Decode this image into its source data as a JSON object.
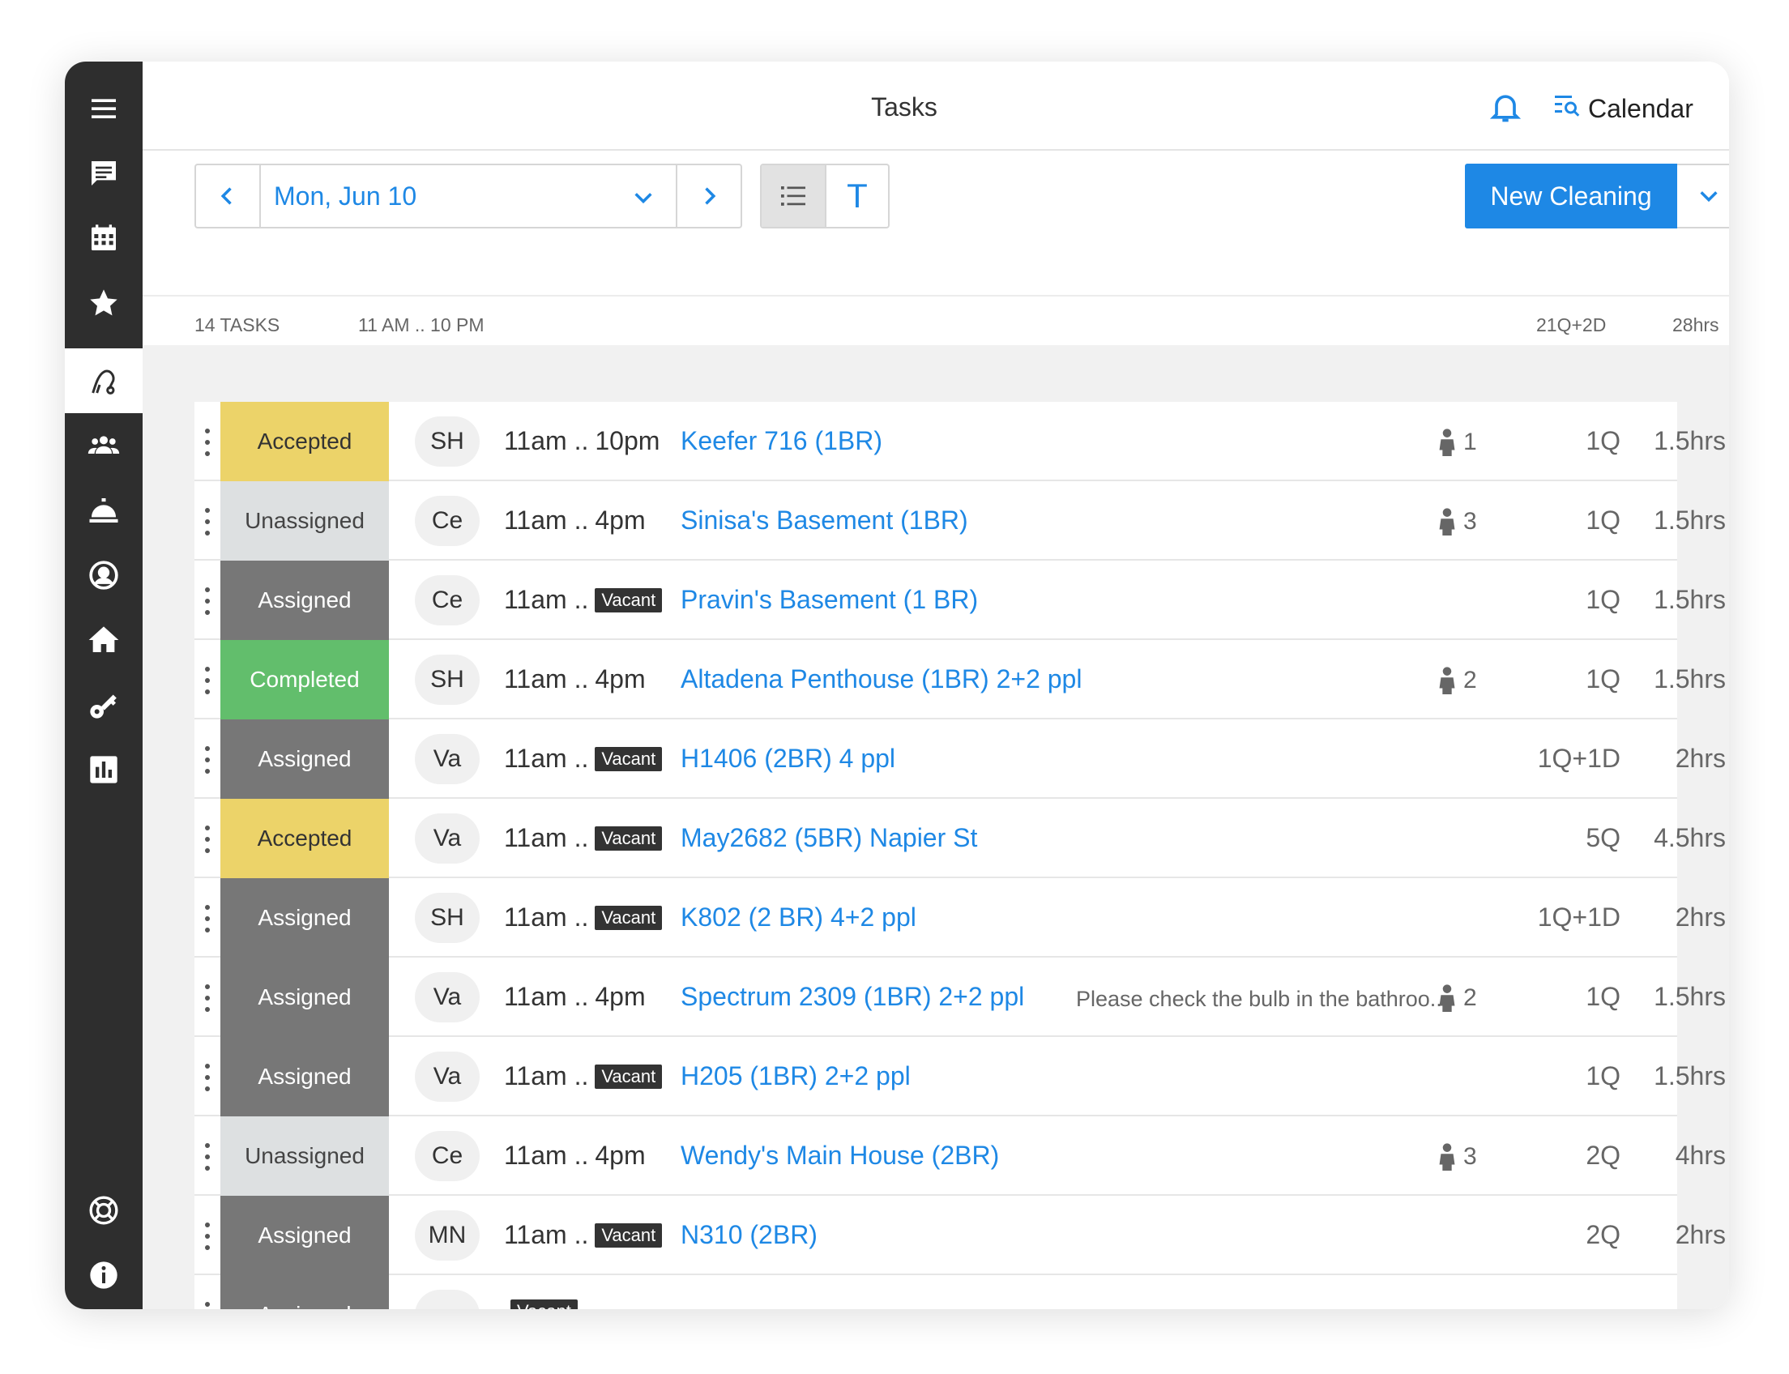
{
  "header": {
    "title": "Tasks",
    "calendar_label": "Calendar"
  },
  "toolbar": {
    "date": "Mon, Jun 10",
    "view_t_label": "T",
    "new_label": "New Cleaning"
  },
  "summary": {
    "tasks": "14 TASKS",
    "range": "11 AM .. 10 PM",
    "qty": "21Q+2D",
    "hours": "28hrs"
  },
  "sidebar": {
    "icons": [
      "menu-icon",
      "messages-icon",
      "calendar-icon",
      "star-icon",
      "cleaning-icon",
      "team-icon",
      "reception-bell-icon",
      "account-icon",
      "home-icon",
      "key-icon",
      "chart-icon",
      "help-icon",
      "info-icon"
    ]
  },
  "colors": {
    "accent": "#1e88e5",
    "accepted": "#ecd369",
    "unassigned": "#dde0e1",
    "assigned": "#777777",
    "completed": "#62be6c",
    "sidebar": "#2e2e2e"
  },
  "tasks": [
    {
      "status": "Accepted",
      "status_key": "accepted",
      "assignee": "SH",
      "time_start": "11am ..",
      "time_end": "10pm",
      "vacant": "",
      "name": "Keefer 716 (1BR)",
      "note": "",
      "guests": "1",
      "qty": "1Q",
      "hours": "1.5hrs"
    },
    {
      "status": "Unassigned",
      "status_key": "unassigned",
      "assignee": "Ce",
      "time_start": "11am ..",
      "time_end": "4pm",
      "vacant": "",
      "name": "Sinisa's Basement (1BR)",
      "note": "",
      "guests": "3",
      "qty": "1Q",
      "hours": "1.5hrs"
    },
    {
      "status": "Assigned",
      "status_key": "assigned",
      "assignee": "Ce",
      "time_start": "11am ..",
      "time_end": "",
      "vacant": "Vacant",
      "name": "Pravin's Basement (1 BR)",
      "note": "",
      "guests": "",
      "qty": "1Q",
      "hours": "1.5hrs"
    },
    {
      "status": "Completed",
      "status_key": "completed",
      "assignee": "SH",
      "time_start": "11am ..",
      "time_end": "4pm",
      "vacant": "",
      "name": "Altadena Penthouse (1BR) 2+2 ppl",
      "note": "",
      "guests": "2",
      "qty": "1Q",
      "hours": "1.5hrs"
    },
    {
      "status": "Assigned",
      "status_key": "assigned",
      "assignee": "Va",
      "time_start": "11am ..",
      "time_end": "",
      "vacant": "Vacant",
      "name": "H1406 (2BR) 4 ppl",
      "note": "",
      "guests": "",
      "qty": "1Q+1D",
      "hours": "2hrs"
    },
    {
      "status": "Accepted",
      "status_key": "accepted",
      "assignee": "Va",
      "time_start": "11am ..",
      "time_end": "",
      "vacant": "Vacant",
      "name": "May2682 (5BR) Napier St",
      "note": "",
      "guests": "",
      "qty": "5Q",
      "hours": "4.5hrs"
    },
    {
      "status": "Assigned",
      "status_key": "assigned",
      "assignee": "SH",
      "time_start": "11am ..",
      "time_end": "",
      "vacant": "Vacant",
      "name": "K802 (2 BR) 4+2 ppl",
      "note": "",
      "guests": "",
      "qty": "1Q+1D",
      "hours": "2hrs"
    },
    {
      "status": "Assigned",
      "status_key": "assigned",
      "assignee": "Va",
      "time_start": "11am ..",
      "time_end": "4pm",
      "vacant": "",
      "name": "Spectrum 2309 (1BR) 2+2 ppl",
      "note": "Please check the bulb in the bathroo...",
      "guests": "2",
      "qty": "1Q",
      "hours": "1.5hrs"
    },
    {
      "status": "Assigned",
      "status_key": "assigned",
      "assignee": "Va",
      "time_start": "11am ..",
      "time_end": "",
      "vacant": "Vacant",
      "name": "H205 (1BR) 2+2 ppl",
      "note": "",
      "guests": "",
      "qty": "1Q",
      "hours": "1.5hrs"
    },
    {
      "status": "Unassigned",
      "status_key": "unassigned",
      "assignee": "Ce",
      "time_start": "11am ..",
      "time_end": "4pm",
      "vacant": "",
      "name": "Wendy's Main House (2BR)",
      "note": "",
      "guests": "3",
      "qty": "2Q",
      "hours": "4hrs"
    },
    {
      "status": "Assigned",
      "status_key": "assigned",
      "assignee": "MN",
      "time_start": "11am ..",
      "time_end": "",
      "vacant": "Vacant",
      "name": "N310 (2BR)",
      "note": "",
      "guests": "",
      "qty": "2Q",
      "hours": "2hrs"
    },
    {
      "status": "Assigned",
      "status_key": "assigned",
      "assignee": "",
      "time_start": "",
      "time_end": "",
      "vacant": "Vacant",
      "name": "",
      "note": "",
      "guests": "",
      "qty": "",
      "hours": ""
    }
  ]
}
